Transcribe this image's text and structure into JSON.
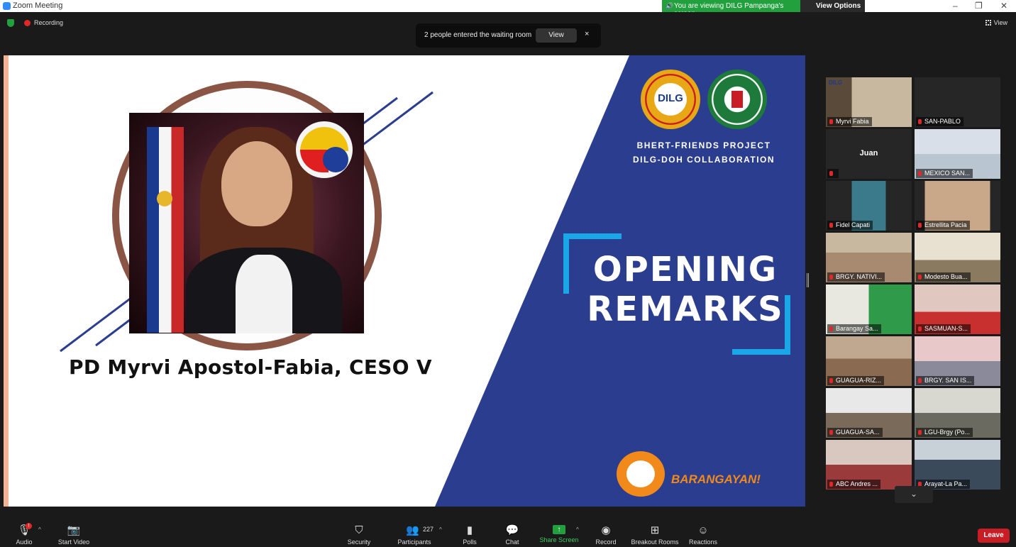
{
  "window": {
    "title": "Zoom Meeting",
    "viewing_banner": "You are viewing DILG Pampanga's screen",
    "view_options": "View Options"
  },
  "topbar": {
    "recording": "Recording",
    "view": "View",
    "notice": "2 people entered the waiting room",
    "notice_button": "View",
    "notice_close": "×"
  },
  "slide": {
    "speaker_caption": "PD Myrvi Apostol-Fabia, CESO V",
    "dilg_seal_text": "DILG",
    "project_line1": "BHERT-FRIENDS PROJECT",
    "project_line2": "DILG-DOH COLLABORATION",
    "heading_line1": "OPENING",
    "heading_line2": "REMARKS",
    "brand": "BARANGAYAN!"
  },
  "gallery": {
    "tiles": [
      {
        "name": "Myrvi Fabia",
        "label_left": "DILG"
      },
      {
        "name": "SAN-PABLO"
      },
      {
        "name": "Juan"
      },
      {
        "name": "MEXICO SAN..."
      },
      {
        "name": "Fidel Capati"
      },
      {
        "name": "Estrellita Pacia"
      },
      {
        "name": "BRGY. NATIVI..."
      },
      {
        "name": "Modesto Bua..."
      },
      {
        "name": "Barangay Sa..."
      },
      {
        "name": "SASMUAN-S..."
      },
      {
        "name": "GUAGUA-RIZ..."
      },
      {
        "name": "BRGY. SAN IS..."
      },
      {
        "name": "GUAGUA-SA..."
      },
      {
        "name": "LGU-Brgy (Po..."
      },
      {
        "name": "ABC Andres ..."
      },
      {
        "name": "Arayat-La Pa..."
      }
    ],
    "page_down": "⌄"
  },
  "toolbar": {
    "audio": "Audio",
    "audio_badge": "!",
    "start_video": "Start Video",
    "security": "Security",
    "participants": "Participants",
    "participants_count": "227",
    "polls": "Polls",
    "chat": "Chat",
    "share_screen": "Share Screen",
    "record": "Record",
    "breakout_rooms": "Breakout Rooms",
    "reactions": "Reactions",
    "leave": "Leave"
  },
  "colors": {
    "slide_blue": "#2b3d8f",
    "accent_cyan": "#19a7e8",
    "share_green": "#23a03e",
    "leave_red": "#c81d25",
    "active_speaker": "#f0e63a"
  }
}
